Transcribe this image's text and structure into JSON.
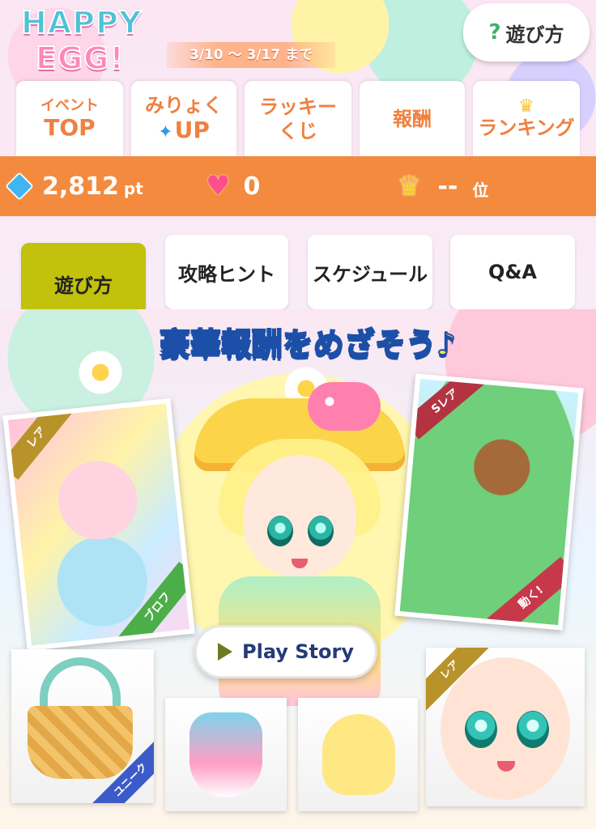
{
  "header": {
    "logo_line1": "HAPPY",
    "logo_line2": "EGG!",
    "period": "3/10 〜 3/17 まで",
    "help_button": {
      "icon": "question-icon",
      "icon_glyph": "?",
      "label": "遊び方"
    }
  },
  "main_tabs": [
    {
      "line1": "イベント",
      "line2": "TOP"
    },
    {
      "line1": "みりょく",
      "line2": "UP",
      "icon": "sparkle-icon"
    },
    {
      "line1": "ラッキー",
      "line2": "くじ"
    },
    {
      "label": "報酬"
    },
    {
      "label": "ランキング",
      "icon": "crown-icon"
    }
  ],
  "status": {
    "points": "2,812",
    "points_unit": "pt",
    "hearts": "0",
    "rank": "--",
    "rank_unit": "位",
    "colors": {
      "bar": "#f38a3e",
      "diamond": "#3fb6f0",
      "heart": "#ff4f8b",
      "crown": "#f6c52a"
    }
  },
  "sub_tabs": [
    {
      "label": "遊び方",
      "active": true
    },
    {
      "label": "攻略ヒント",
      "active": false
    },
    {
      "label": "スケジュール",
      "active": false
    },
    {
      "label": "Q&A",
      "active": false
    }
  ],
  "banner": {
    "title": "豪華報酬をめざそう♪",
    "card_left": {
      "rarity": "レア",
      "type": "ブロフ"
    },
    "card_right": {
      "rarity": "Sレア",
      "type": "動く!"
    },
    "play_button": {
      "icon": "play-icon",
      "label": "Play Story"
    },
    "items": {
      "basket": {
        "type": "ユニーク"
      },
      "face": {
        "rarity": "レア"
      }
    }
  }
}
